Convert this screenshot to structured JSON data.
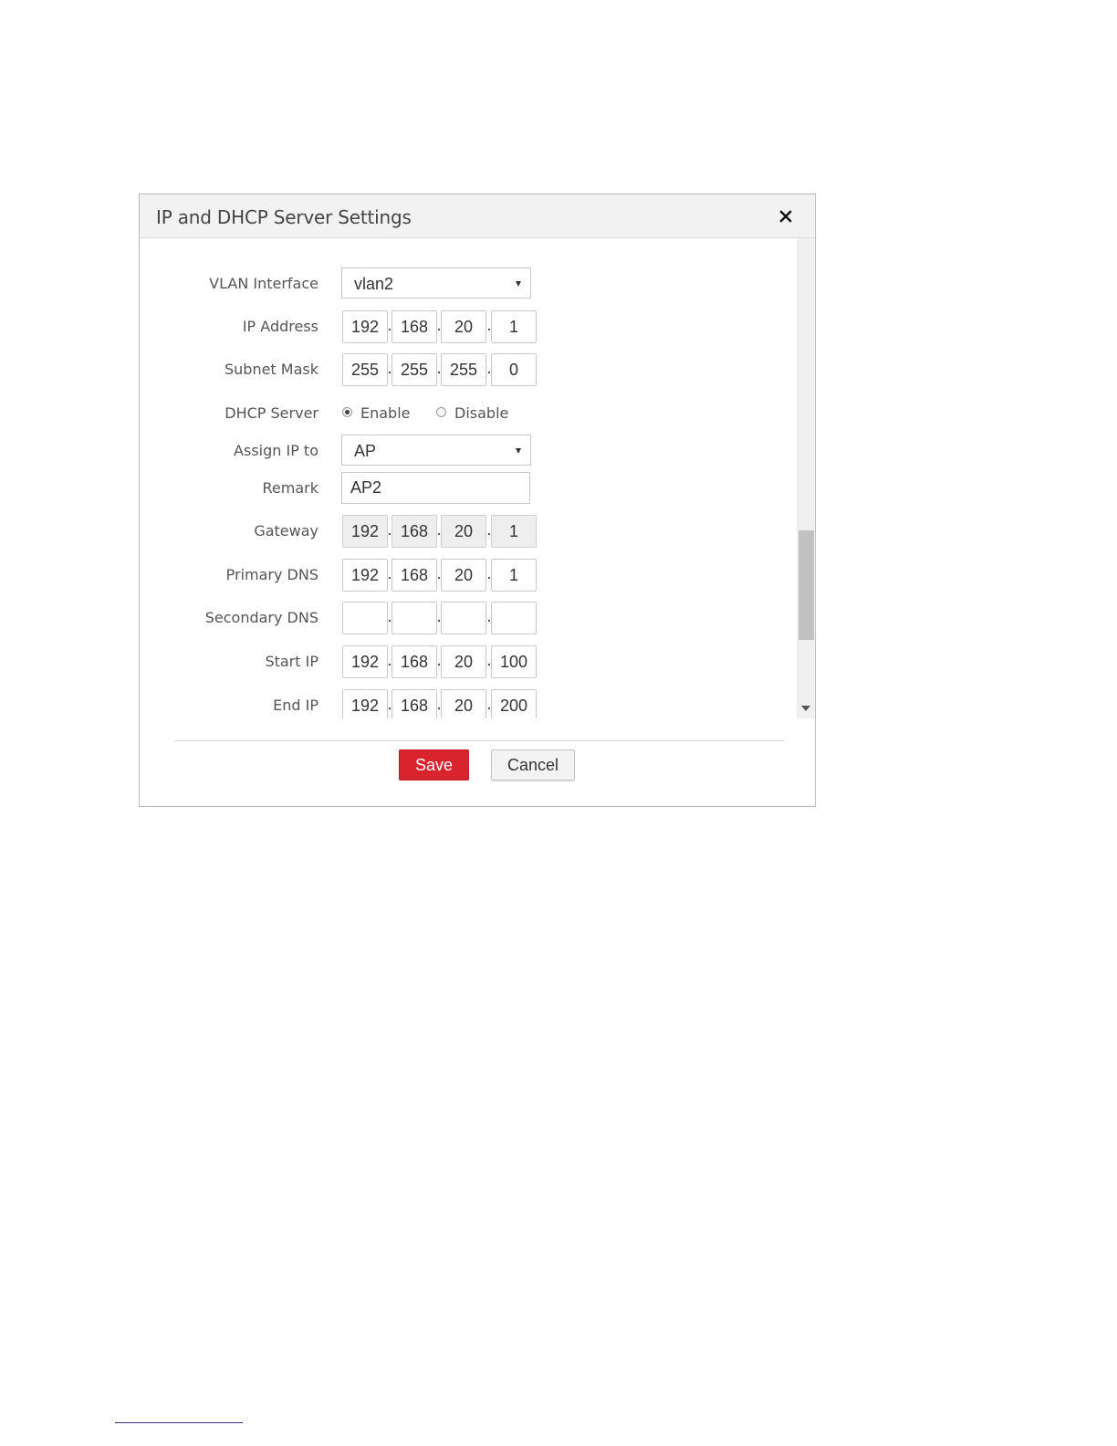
{
  "dialog": {
    "title": "IP and DHCP Server Settings",
    "close_icon": "close-icon"
  },
  "form": {
    "vlan_interface": {
      "label": "VLAN Interface",
      "value": "vlan2"
    },
    "ip_address": {
      "label": "IP Address",
      "octets": [
        "192",
        "168",
        "20",
        "1"
      ]
    },
    "subnet_mask": {
      "label": "Subnet Mask",
      "octets": [
        "255",
        "255",
        "255",
        "0"
      ]
    },
    "dhcp_server": {
      "label": "DHCP Server",
      "options": [
        {
          "label": "Enable",
          "checked": true
        },
        {
          "label": "Disable",
          "checked": false
        }
      ]
    },
    "assign_ip_to": {
      "label": "Assign IP to",
      "value": "AP"
    },
    "remark": {
      "label": "Remark",
      "value": "AP2"
    },
    "gateway": {
      "label": "Gateway",
      "octets": [
        "192",
        "168",
        "20",
        "1"
      ]
    },
    "primary_dns": {
      "label": "Primary DNS",
      "octets": [
        "192",
        "168",
        "20",
        "1"
      ]
    },
    "secondary_dns": {
      "label": "Secondary DNS",
      "octets": [
        "",
        "",
        "",
        ""
      ]
    },
    "start_ip": {
      "label": "Start IP",
      "octets": [
        "192",
        "168",
        "20",
        "100"
      ]
    },
    "end_ip": {
      "label": "End IP",
      "octets": [
        "192",
        "168",
        "20",
        "200"
      ]
    }
  },
  "buttons": {
    "save_label": "Save",
    "cancel_label": "Cancel"
  },
  "colors": {
    "save_button": "#d9232d",
    "header_background": "#f2f2f2"
  }
}
